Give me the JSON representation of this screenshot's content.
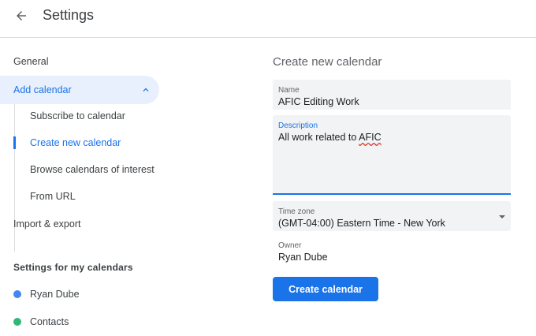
{
  "header": {
    "title": "Settings",
    "back_icon": "arrow-back-icon"
  },
  "sidebar": {
    "general": "General",
    "add_calendar": "Add calendar",
    "sub_items": [
      "Subscribe to calendar",
      "Create new calendar",
      "Browse calendars of interest",
      "From URL"
    ],
    "active_sub_item": "Create new calendar",
    "import_export": "Import & export",
    "my_calendars_title": "Settings for my calendars",
    "calendars": [
      {
        "name": "Ryan Dube",
        "color": "#4285f4"
      },
      {
        "name": "Contacts",
        "color": "#33b679"
      }
    ]
  },
  "form": {
    "title": "Create new calendar",
    "name_label": "Name",
    "name_value": "AFIC Editing Work",
    "description_label": "Description",
    "description_prefix": "All work related to ",
    "description_misspelled": "AFIC",
    "timezone_label": "Time zone",
    "timezone_value": "(GMT-04:00) Eastern Time - New York",
    "owner_label": "Owner",
    "owner_value": "Ryan Dube",
    "submit_label": "Create calendar"
  },
  "colors": {
    "accent": "#1a73e8",
    "active_bg": "#e8f0fe",
    "field_bg": "#f1f3f4"
  }
}
